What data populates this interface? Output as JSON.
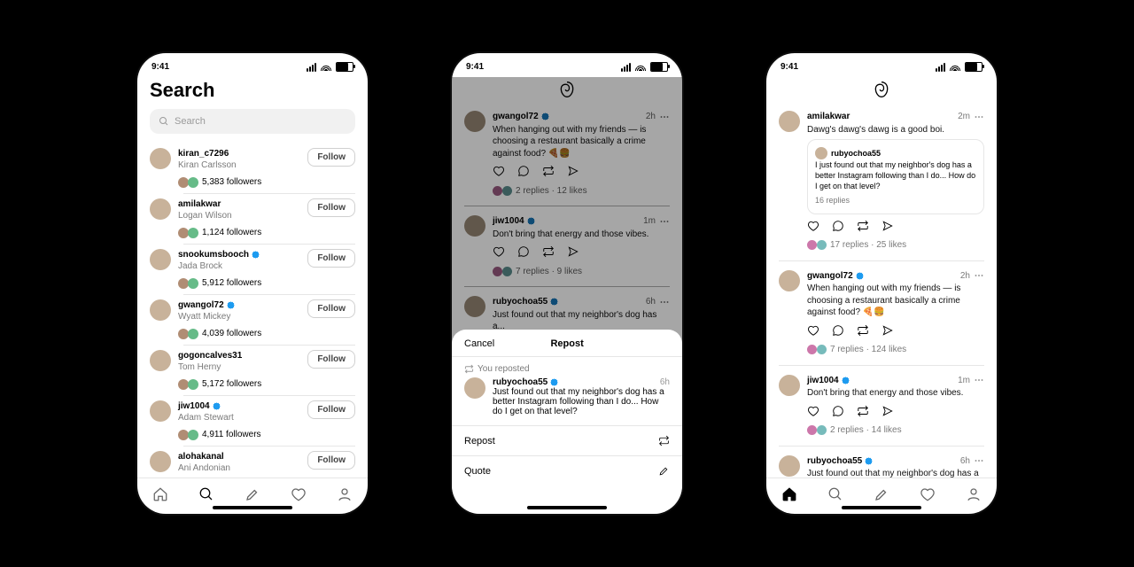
{
  "clock": "9:41",
  "search_title": "Search",
  "search_placeholder": "Search",
  "follow_label": "Follow",
  "search_results": [
    {
      "u": "kiran_c7296",
      "n": "Kiran Carlsson",
      "f": "5,383 followers",
      "v": false
    },
    {
      "u": "amilakwar",
      "n": "Logan Wilson",
      "f": "1,124 followers",
      "v": false
    },
    {
      "u": "snookumsbooch",
      "n": "Jada Brock",
      "f": "5,912 followers",
      "v": true
    },
    {
      "u": "gwangol72",
      "n": "Wyatt Mickey",
      "f": "4,039 followers",
      "v": true
    },
    {
      "u": "gogoncalves31",
      "n": "Tom Herny",
      "f": "5,172 followers",
      "v": false
    },
    {
      "u": "jiw1004",
      "n": "Adam Stewart",
      "f": "4,911 followers",
      "v": true
    },
    {
      "u": "alohakanal",
      "n": "Ani Andonian",
      "f": "",
      "v": false
    }
  ],
  "sheet": {
    "cancel": "Cancel",
    "title": "Repost",
    "reposted_label": "You reposted",
    "opt_repost": "Repost",
    "opt_quote": "Quote",
    "card": {
      "u": "rubyochoa55",
      "ts": "6h",
      "v": true,
      "txt": "Just found out that my neighbor's dog has a better Instagram following than I do... How do I get on that level? "
    }
  },
  "feed2": [
    {
      "u": "gwangol72",
      "ts": "2h",
      "v": true,
      "txt": "When hanging out with my friends — is choosing a restaurant basically a crime against food? 🍕🍔",
      "r": "2 replies",
      "l": "12 likes"
    },
    {
      "u": "jiw1004",
      "ts": "1m",
      "v": true,
      "txt": "Don't bring that energy and those vibes.",
      "r": "7 replies",
      "l": "9 likes"
    },
    {
      "u": "rubyochoa55",
      "ts": "6h",
      "v": true,
      "txt": "Just found out that my neighbor's dog has a..."
    }
  ],
  "feed3_top": {
    "u": "amilakwar",
    "ts": "2m",
    "v": false,
    "txt": "Dawg's dawg's dawg is a good boi.",
    "quote": {
      "u": "rubyochoa55",
      "txt": "I just found out that my neighbor's dog has a better Instagram following than I do... How do I get on that level?",
      "more": "16 replies"
    },
    "r": "17 replies",
    "l": "25 likes"
  },
  "feed3_rest": [
    {
      "u": "gwangol72",
      "ts": "2h",
      "v": true,
      "txt": "When hanging out with my friends — is choosing a restaurant basically a crime against food? 🍕🍔",
      "r": "7 replies",
      "l": "124 likes"
    },
    {
      "u": "jiw1004",
      "ts": "1m",
      "v": true,
      "txt": "Don't bring that energy and those vibes.",
      "r": "2 replies",
      "l": "14 likes"
    },
    {
      "u": "rubyochoa55",
      "ts": "6h",
      "v": true,
      "txt": "Just found out that my neighbor's dog has a better Instagram following than I do..."
    }
  ]
}
